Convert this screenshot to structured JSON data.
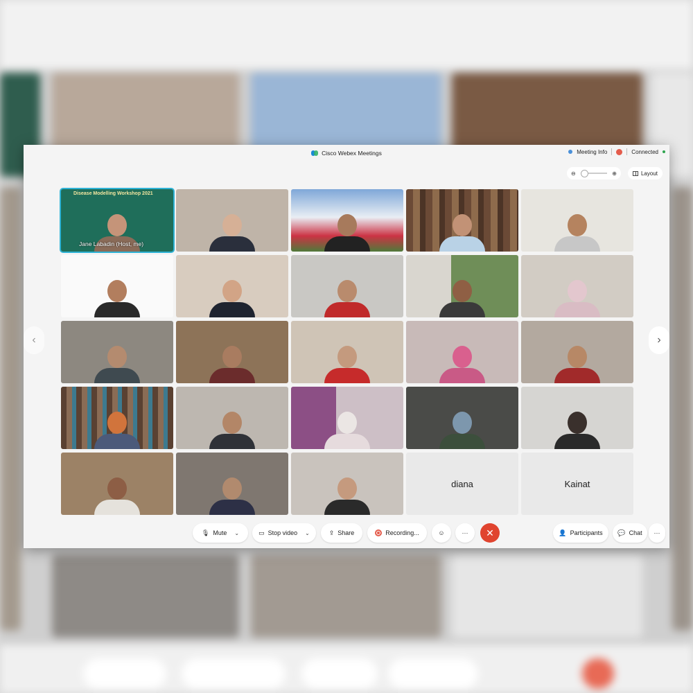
{
  "window": {
    "title": "Cisco Webex Meetings",
    "meeting_info_label": "Meeting Info",
    "status": "Connected"
  },
  "view": {
    "layout_label": "Layout",
    "zoom_out_icon": "zoom-out-icon",
    "zoom_in_icon": "zoom-in-icon"
  },
  "participants": [
    {
      "name": "Jane Labadin",
      "role": "(Host, me)",
      "active": true,
      "board_text": "Disease Modelling Workshop 2021",
      "video": true
    },
    {
      "name": "",
      "video": true
    },
    {
      "name": "",
      "video": true
    },
    {
      "name": "",
      "video": true
    },
    {
      "name": "",
      "video": true
    },
    {
      "name": "",
      "video": true
    },
    {
      "name": "",
      "video": true
    },
    {
      "name": "",
      "video": true
    },
    {
      "name": "",
      "video": true
    },
    {
      "name": "",
      "video": true
    },
    {
      "name": "",
      "video": true
    },
    {
      "name": "",
      "video": true
    },
    {
      "name": "",
      "video": true
    },
    {
      "name": "",
      "video": true
    },
    {
      "name": "",
      "video": true
    },
    {
      "name": "",
      "video": true
    },
    {
      "name": "",
      "video": true
    },
    {
      "name": "",
      "video": true
    },
    {
      "name": "",
      "video": true
    },
    {
      "name": "",
      "video": true
    },
    {
      "name": "",
      "video": true
    },
    {
      "name": "",
      "video": true
    },
    {
      "name": "",
      "video": true
    },
    {
      "name": "diana",
      "video": false
    },
    {
      "name": "Kainat",
      "video": false
    }
  ],
  "toolbar": {
    "mute_label": "Mute",
    "stop_video_label": "Stop video",
    "share_label": "Share",
    "recording_label": "Recording...",
    "participants_label": "Participants",
    "chat_label": "Chat",
    "more_label": "···",
    "end_icon": "✕"
  },
  "colors": {
    "active_border": "#2fb3d6",
    "end_button": "#e0442f",
    "recording": "#e45c4c",
    "connected": "#2ea44f"
  }
}
